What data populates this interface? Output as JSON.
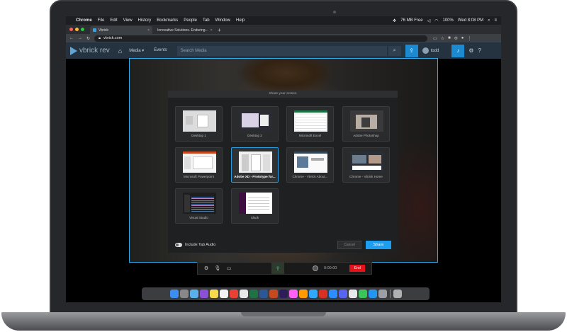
{
  "menubar": {
    "apple": "",
    "app": "Chrome",
    "items": [
      "File",
      "Edit",
      "View",
      "History",
      "Bookmarks",
      "People",
      "Tab",
      "Window",
      "Help"
    ],
    "status": [
      "76 MB Free",
      "100%"
    ],
    "clock": "Wed 8:08 PM"
  },
  "tabs": [
    {
      "title": "Vbrick",
      "color": "#3aa0e0"
    },
    {
      "title": "Innovative Solutions. Enduring...",
      "color": "#e33b3b"
    }
  ],
  "url": "vbrick.com",
  "rev": {
    "logo": "vbrick rev",
    "nav": [
      "Media",
      "Events"
    ],
    "search_placeholder": "Search Media",
    "user": "todd"
  },
  "modal": {
    "title": "Share your screen",
    "sources": [
      {
        "label": "Desktop 1",
        "selected": false
      },
      {
        "label": "Desktop 2",
        "selected": false
      },
      {
        "label": "Microsoft Excel",
        "selected": false
      },
      {
        "label": "Adobe Photoshop",
        "selected": false
      },
      {
        "label": "Microsoft Powerpoint",
        "selected": false
      },
      {
        "label": "Adobe XD - Prototype for...",
        "selected": true
      },
      {
        "label": "Chrome - Vbrick About...",
        "selected": false
      },
      {
        "label": "Chrome - Vbrick Home",
        "selected": false
      },
      {
        "label": "Visual Studio",
        "selected": false
      },
      {
        "label": "Slack",
        "selected": false
      }
    ],
    "include_audio": "Include Tab Audio",
    "cancel": "Cancel",
    "share": "Share"
  },
  "recorder": {
    "time": "0:00:00",
    "end": "End"
  },
  "colors": {
    "accent": "#1d9ef0",
    "end": "#e3121b",
    "rev_header": "#253341"
  },
  "icons": [
    "apple-icon",
    "home-icon",
    "search-icon",
    "upload-icon",
    "bell-icon",
    "settings-icon",
    "help-icon",
    "camera-icon",
    "microphone-icon",
    "share-icon",
    "record-icon"
  ]
}
